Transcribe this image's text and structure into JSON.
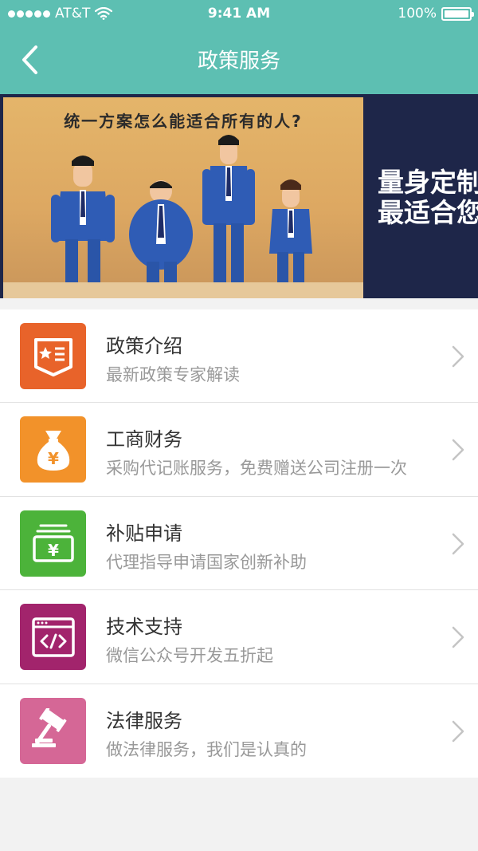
{
  "status_bar": {
    "carrier": "AT&T",
    "time": "9:41 AM",
    "battery": "100%"
  },
  "nav": {
    "title": "政策服务",
    "back_icon": "chevron-left-icon"
  },
  "banner": {
    "question": "统一方案怎么能适合所有的人?",
    "slogan_line1": "量身定制",
    "slogan_line2": "最适合您"
  },
  "services": [
    {
      "title": "政策介绍",
      "desc": "最新政策专家解读",
      "icon": "policy-document-icon",
      "color": "#e8632a"
    },
    {
      "title": "工商财务",
      "desc": "采购代记账服务，免费赠送公司注册一次",
      "icon": "money-bag-icon",
      "color": "#f2922a"
    },
    {
      "title": "补贴申请",
      "desc": "代理指导申请国家创新补助",
      "icon": "subsidy-cash-icon",
      "color": "#4cb33a"
    },
    {
      "title": "技术支持",
      "desc": "微信公众号开发五折起",
      "icon": "code-window-icon",
      "color": "#a2246c"
    },
    {
      "title": "法律服务",
      "desc": "做法律服务，我们是认真的",
      "icon": "gavel-icon",
      "color": "#d56796"
    }
  ],
  "colors": {
    "header": "#5dbfb2",
    "banner_dark": "#1e2649"
  }
}
